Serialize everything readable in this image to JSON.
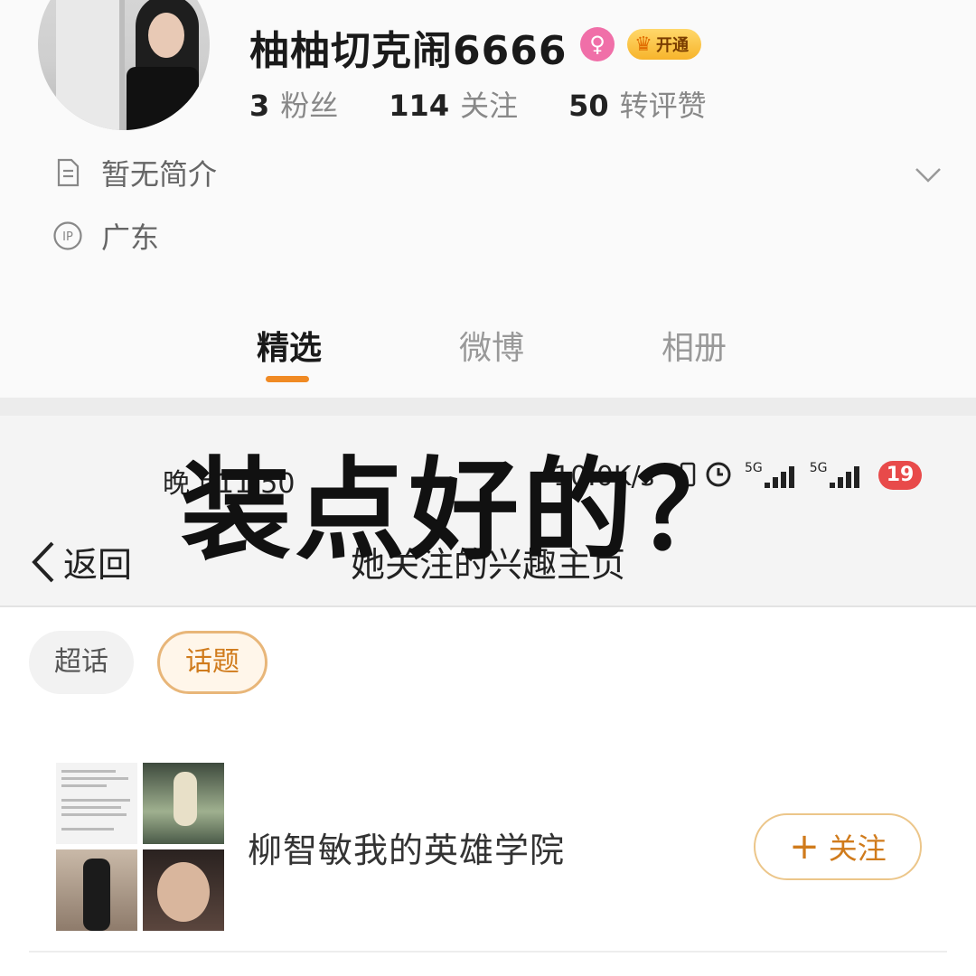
{
  "profile": {
    "username": "柚柚切克闹6666",
    "gender_icon": "female-icon",
    "gender_symbol": "♀",
    "vip_label": "开通",
    "stats": {
      "fans_num": "3",
      "fans_label": "粉丝",
      "following_num": "114",
      "following_label": "关注",
      "likes_num": "50",
      "likes_label": "转评赞"
    },
    "bio": "暂无简介",
    "ip_location": "广东"
  },
  "tabs": [
    {
      "label": "精选",
      "active": true
    },
    {
      "label": "微博",
      "active": false
    },
    {
      "label": "相册",
      "active": false
    }
  ],
  "status_bar": {
    "time": "晚上11:50",
    "speed": "10.0K/s",
    "signal_1": "5G",
    "signal_2": "5G",
    "notification_count": "19"
  },
  "nav": {
    "back_label": "返回",
    "title": "她关注的兴趣主页"
  },
  "overlay_caption": "装点好的？",
  "chips": [
    {
      "label": "超话",
      "active": false
    },
    {
      "label": "话题",
      "active": true
    }
  ],
  "topic": {
    "name": "柳智敏我的英雄学院",
    "follow_label": "关注",
    "follow_icon": "plus-icon"
  },
  "colors": {
    "accent": "#f08a24",
    "gender_pink": "#f06fa8",
    "badge_red": "#e84a4a",
    "chip_active": "#d07b1c"
  }
}
